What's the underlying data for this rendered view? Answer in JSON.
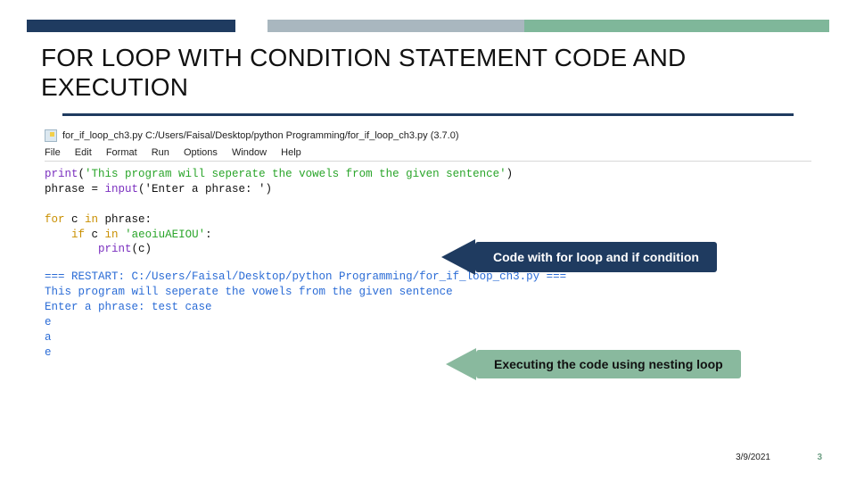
{
  "slide": {
    "title": "FOR LOOP WITH CONDITION STATEMENT CODE AND EXECUTION",
    "date": "3/9/2021",
    "number": "3"
  },
  "editor": {
    "titlebar": "for_if_loop_ch3.py  C:/Users/Faisal/Desktop/python Programming/for_if_loop_ch3.py (3.7.0)",
    "menu": {
      "file": "File",
      "edit": "Edit",
      "format": "Format",
      "run": "Run",
      "options": "Options",
      "window": "Window",
      "help": "Help"
    }
  },
  "code": {
    "print_kw": "print",
    "print_open": "(",
    "print_str": "'This program will seperate the vowels from the given sentence'",
    "print_close": ")",
    "assign_lhs": "phrase = ",
    "input_kw": "input",
    "input_arg": "('Enter a phrase: ')",
    "for_kw": "for",
    "for_rest": " c ",
    "in_kw": "in",
    "for_tail": " phrase:",
    "if_indent": "    ",
    "if_kw": "if",
    "if_mid": " c ",
    "in_kw2": "in",
    "if_cond": " 'aeoiuAEIOU'",
    "if_colon": ":",
    "body_indent": "        ",
    "body_print": "print",
    "body_arg": "(c)"
  },
  "shell": {
    "restart": "=== RESTART: C:/Users/Faisal/Desktop/python Programming/for_if_loop_ch3.py ===",
    "l1": "This program will seperate the vowels from the given sentence",
    "l2": "Enter a phrase: test case",
    "l3": "e",
    "l4": "a",
    "l5": "e"
  },
  "callouts": {
    "code_label": "Code with for loop and if condition",
    "exec_label": "Executing the code using nesting loop"
  }
}
